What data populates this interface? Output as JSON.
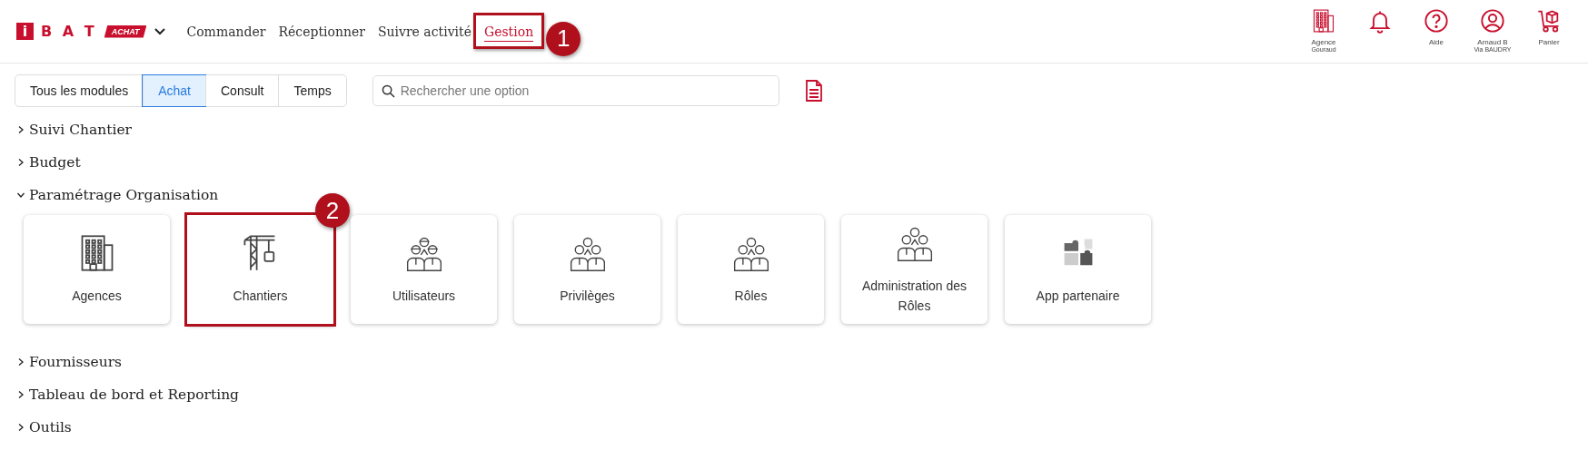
{
  "logo": {
    "mark": "i",
    "name": "B A T",
    "badge": "ACHAT"
  },
  "nav": [
    {
      "label": "Commander",
      "selected": false
    },
    {
      "label": "Réceptionner",
      "selected": false
    },
    {
      "label": "Suivre activité",
      "selected": false
    },
    {
      "label": "Gestion",
      "selected": true,
      "callout": "1"
    }
  ],
  "header_actions": [
    {
      "kind": "building",
      "label": "Agence",
      "sublabel": "Gouraud"
    },
    {
      "kind": "bell"
    },
    {
      "kind": "help",
      "label": "Aide"
    },
    {
      "kind": "user",
      "label": "Arnaud B",
      "sublabel": "Via BAUDRY"
    },
    {
      "kind": "cart",
      "label": "Panier"
    }
  ],
  "module_tabs": [
    {
      "label": "Tous les modules",
      "selected": false
    },
    {
      "label": "Achat",
      "selected": true
    },
    {
      "label": "Consult",
      "selected": false
    },
    {
      "label": "Temps",
      "selected": false
    }
  ],
  "search": {
    "placeholder": "Rechercher une option"
  },
  "sections": [
    {
      "title": "Suivi Chantier",
      "expanded": false
    },
    {
      "title": "Budget",
      "expanded": false
    },
    {
      "title": "Paramétrage Organisation",
      "expanded": true,
      "tiles": [
        {
          "kind": "building",
          "label": "Agences"
        },
        {
          "kind": "crane",
          "label": "Chantiers",
          "callout": "2"
        },
        {
          "kind": "workers",
          "label": "Utilisateurs"
        },
        {
          "kind": "team",
          "label": "Privilèges"
        },
        {
          "kind": "team",
          "label": "Rôles"
        },
        {
          "kind": "team",
          "label": "Administration des Rôles"
        },
        {
          "kind": "puzzle",
          "label": "App partenaire"
        }
      ]
    },
    {
      "title": "Fournisseurs",
      "expanded": false
    },
    {
      "title": "Tableau de bord et Reporting",
      "expanded": false
    },
    {
      "title": "Outils",
      "expanded": false
    }
  ]
}
